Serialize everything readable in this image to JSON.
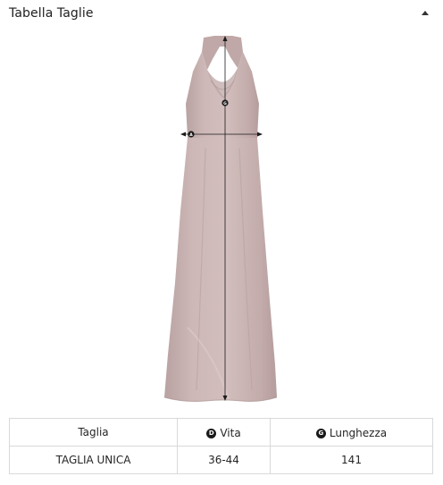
{
  "panel": {
    "title": "Tabella Taglie",
    "toggle_icon": "caret-up-icon"
  },
  "figure": {
    "dress_color": "#c9b3b2",
    "measure_markers": [
      "A",
      "G"
    ]
  },
  "size_table": {
    "headers": {
      "size": "Taglia",
      "waist": {
        "badge": "D",
        "label": "Vita"
      },
      "length": {
        "badge": "G",
        "label": "Lunghezza"
      }
    },
    "rows": [
      {
        "size": "TAGLIA UNICA",
        "waist": "36-44",
        "length": "141"
      }
    ]
  }
}
